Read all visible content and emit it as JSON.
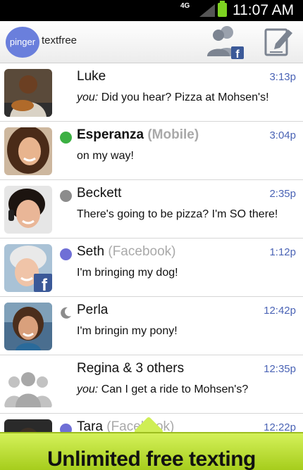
{
  "status_bar": {
    "network": "4G",
    "time": "11:07 AM"
  },
  "header": {
    "logo_text": "pinger",
    "brand_text": "textfree"
  },
  "conversations": [
    {
      "name": "Luke",
      "sub": "",
      "time": "3:13p",
      "prefix": "you:",
      "message": "Did you hear? Pizza at Mohsen's!",
      "presence": "none",
      "bold": false
    },
    {
      "name": "Esperanza",
      "sub": "(Mobile)",
      "time": "3:04p",
      "prefix": "",
      "message": "on my way!",
      "presence": "online",
      "bold": true
    },
    {
      "name": "Beckett",
      "sub": "",
      "time": "2:35p",
      "prefix": "",
      "message": "There's going to be pizza? I'm SO there!",
      "presence": "offline",
      "bold": false
    },
    {
      "name": "Seth",
      "sub": "(Facebook)",
      "time": "1:12p",
      "prefix": "",
      "message": "I'm bringing my dog!",
      "presence": "facebook",
      "bold": false
    },
    {
      "name": "Perla",
      "sub": "",
      "time": "12:42p",
      "prefix": "",
      "message": "I'm bringin my pony!",
      "presence": "away",
      "bold": false
    },
    {
      "name": "Regina & 3 others",
      "sub": "",
      "time": "12:35p",
      "prefix": "you:",
      "message": "Can I get a ride to Mohsen's?",
      "presence": "none",
      "bold": false
    },
    {
      "name": "Tara",
      "sub": "(Facebook)",
      "time": "12:22p",
      "prefix": "",
      "message": "",
      "presence": "facebook",
      "bold": false
    }
  ],
  "banner": {
    "text": "Unlimited free texting"
  },
  "colors": {
    "accent": "#4a63b5",
    "online": "#3cb043",
    "offline": "#8c8c8c",
    "facebook": "#6f6fd6",
    "banner": "#b8dc2c"
  },
  "icons": [
    "signal-icon",
    "battery-icon",
    "facebook-contacts-icon",
    "compose-icon",
    "presence-dot-icon",
    "moon-icon",
    "group-icon"
  ]
}
